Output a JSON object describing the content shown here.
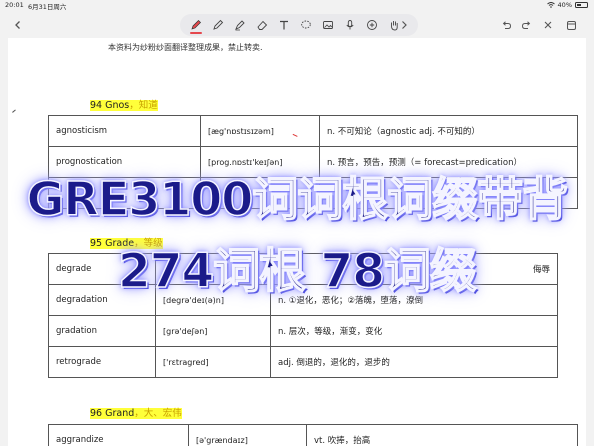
{
  "status_bar": {
    "time": "20:01",
    "date": "6月31日周六",
    "battery": "40%"
  },
  "toolbar": {
    "back_icon": "chevron-left-icon",
    "tools": [
      {
        "name": "pen-tool",
        "icon": "pen-icon",
        "active": true
      },
      {
        "name": "pencil-tool",
        "icon": "pencil-icon",
        "active": false
      },
      {
        "name": "marker-tool",
        "icon": "marker-icon",
        "active": false
      },
      {
        "name": "eraser-tool",
        "icon": "eraser-icon",
        "active": false
      },
      {
        "name": "text-tool",
        "icon": "text-icon",
        "active": false
      },
      {
        "name": "lasso-tool",
        "icon": "lasso-icon",
        "active": false
      },
      {
        "name": "image-tool",
        "icon": "image-icon",
        "active": false
      },
      {
        "name": "mic-tool",
        "icon": "mic-icon",
        "active": false
      },
      {
        "name": "add-tool",
        "icon": "plus-icon",
        "active": false
      },
      {
        "name": "hand-tool",
        "icon": "hand-icon",
        "active": false
      },
      {
        "name": "more-tools",
        "icon": "chevron-right-icon",
        "active": false
      }
    ],
    "right_icons": [
      "undo-icon",
      "redo-icon",
      "close-icon",
      "pages-icon"
    ]
  },
  "document": {
    "notice": "本资料为纱粉纱面翻译整理成果，禁止转卖.",
    "sections": [
      {
        "heading": "94 Gnos",
        "heading_cn": "，知道",
        "rows": [
          {
            "word": "agnosticism",
            "ipa": "[æg'nɒstɪsɪzəm]",
            "meaning": "n. 不可知论（agnostic adj. 不可知的）"
          },
          {
            "word": "prognostication",
            "ipa": "[prog.nɒstɪ'keɪʃən]",
            "meaning": "n. 预言，预告，预测（= forecast=predication）"
          },
          {
            "word": "",
            "ipa": "",
            "meaning": ""
          }
        ]
      },
      {
        "heading": "95 Grade",
        "heading_cn": "，等级",
        "rows": [
          {
            "word": "degrade",
            "ipa": "",
            "meaning": "侮辱"
          },
          {
            "word": "degradation",
            "ipa": "[degrə'deɪ(ə)n]",
            "meaning": "n. ①退化，恶化；②落魄，堕落，潦倒"
          },
          {
            "word": "gradation",
            "ipa": "[grə'deʃən]",
            "meaning": "n. 层次，等级，渐变，变化"
          },
          {
            "word": "retrograde",
            "ipa": "['rɛtragred]",
            "meaning": "adj. 倒退的，退化的，退步的"
          }
        ]
      },
      {
        "heading": "96 Grand",
        "heading_cn": "，大、宏伟",
        "rows": [
          {
            "word": "aggrandize",
            "ipa": "[ə'grændaɪz]",
            "meaning": "vt. 吹捧，抬高"
          }
        ]
      }
    ]
  },
  "overlay": {
    "line1": "GRE3100词词根词缀带背",
    "line2": "274词根 78词缀"
  }
}
